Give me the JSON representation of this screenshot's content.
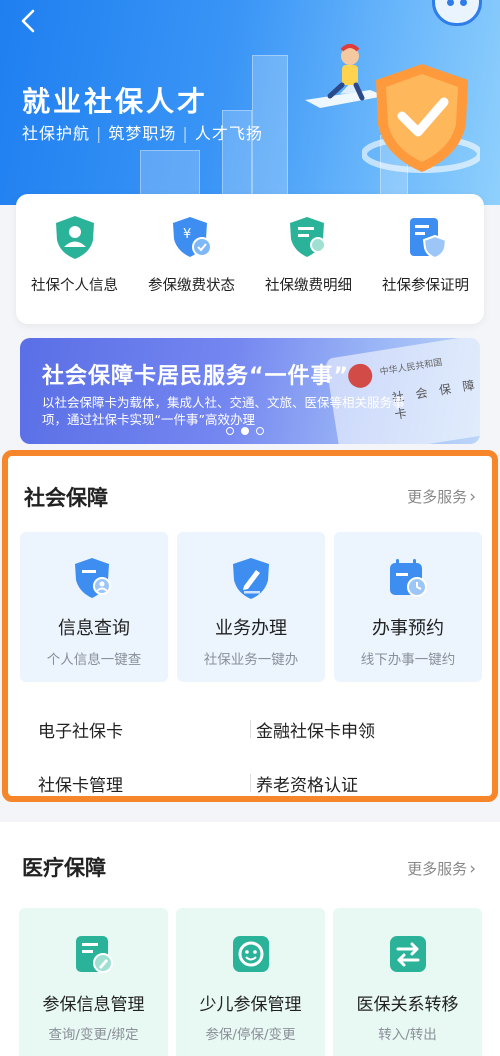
{
  "hero": {
    "title": "就业社保人才",
    "subtitle_parts": [
      "社保护航",
      "筑梦职场",
      "人才飞扬"
    ],
    "colors": {
      "primary": "#1f7ff0",
      "light": "#8fd0fd"
    }
  },
  "quick_entries": [
    {
      "label": "社保个人信息",
      "icon": "person-shield-icon"
    },
    {
      "label": "参保缴费状态",
      "icon": "yuan-check-shield-icon"
    },
    {
      "label": "社保缴费明细",
      "icon": "document-search-icon"
    },
    {
      "label": "社保参保证明",
      "icon": "certificate-shield-icon"
    }
  ],
  "banner": {
    "title": "社会保障卡居民服务“一件事”",
    "description": "以社会保障卡为载体，集成人社、交通、文旅、医保等相关服务事项，通过社保卡实现“一件事”高效办理",
    "card_text": "社 会 保 障 卡",
    "card_header": "中华人民共和国",
    "page_count": 3,
    "active_page": 2
  },
  "social": {
    "title": "社会保障",
    "more": "更多服务",
    "tiles": [
      {
        "title": "信息查询",
        "sub": "个人信息一键查",
        "icon": "person-card-shield-icon"
      },
      {
        "title": "业务办理",
        "sub": "社保业务一键办",
        "icon": "pen-shield-icon"
      },
      {
        "title": "办事预约",
        "sub": "线下办事一键约",
        "icon": "calendar-clock-icon"
      }
    ],
    "links": [
      [
        "电子社保卡",
        "金融社保卡申领"
      ],
      [
        "社保卡管理",
        "养老资格认证"
      ]
    ],
    "highlight_color": "#f7862b"
  },
  "medical": {
    "title": "医疗保障",
    "more": "更多服务",
    "tiles": [
      {
        "title": "参保信息管理",
        "sub": "查询/变更/绑定",
        "icon": "document-edit-icon"
      },
      {
        "title": "少儿参保管理",
        "sub": "参保/停保/变更",
        "icon": "child-face-icon"
      },
      {
        "title": "医保关系转移",
        "sub": "转入/转出",
        "icon": "transfer-arrows-icon"
      }
    ],
    "accent_color": "#2bb39a"
  }
}
